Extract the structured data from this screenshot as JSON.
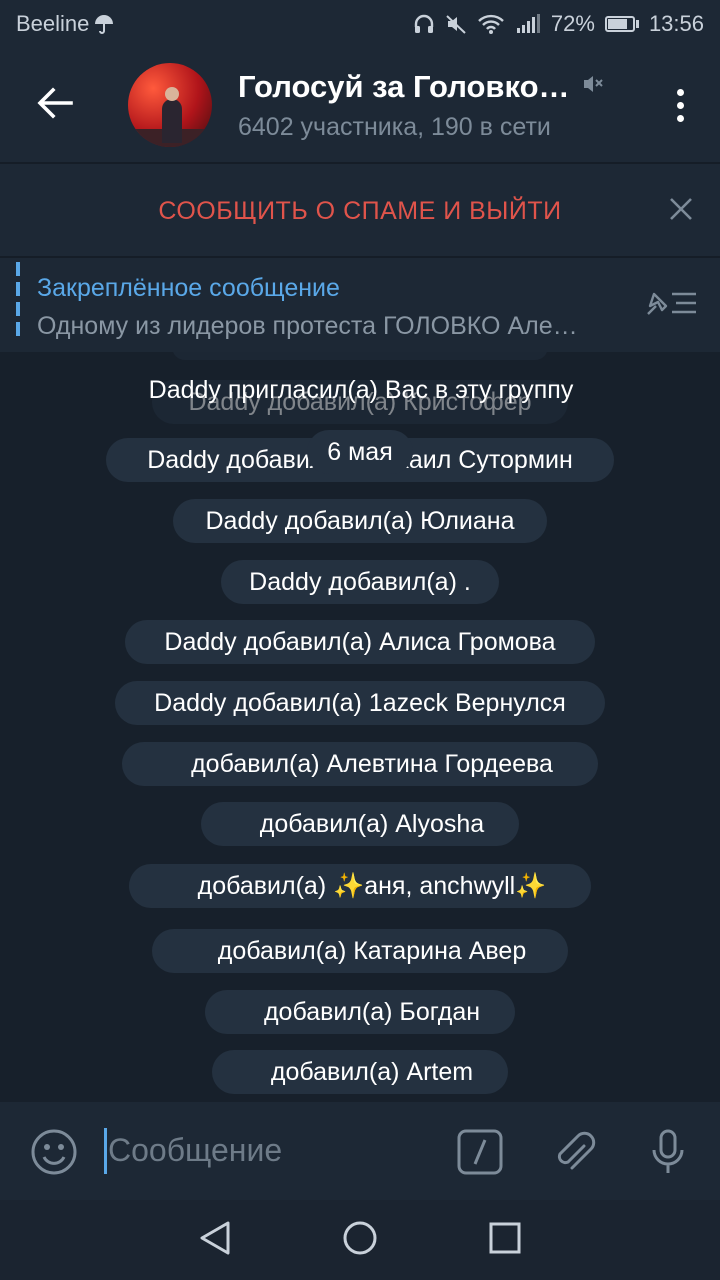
{
  "status_bar": {
    "carrier": "Beeline",
    "battery": "72%",
    "battery_level": 0.72,
    "time": "13:56"
  },
  "header": {
    "title": "Голосуй за Головко…",
    "subtitle": "6402 участника, 190 в сети"
  },
  "spam_bar": {
    "label": "СООБЩИТЬ О СПАМЕ И ВЫЙТИ"
  },
  "pinned": {
    "title": "Закреплённое сообщение",
    "text": "Одному из лидеров протеста ГОЛОВКО Але…"
  },
  "messages": {
    "ghost1": "Daddy добавил(а) Кристофер",
    "invite": "Daddy пригласил(а) Вас в эту группу",
    "date": "6 мая",
    "m1": "Daddy добавил(а) Михаил Сутормин",
    "m2": "Daddy добавил(а) Юлиана",
    "m3": "Daddy добавил(а) .",
    "m4": "Daddy добавил(а) Алиса Громова",
    "m5": "Daddy добавил(а) 1azeck Вернулся",
    "m6": "добавил(а) Алевтина Гордеева",
    "m7": "добавил(а) Alyosha",
    "m8": "добавил(а) ✨аня, anchwyll✨",
    "m9": "добавил(а) Катарина Авер",
    "m10": "добавил(а) Богдан",
    "m11": "добавил(а) Artem"
  },
  "composer": {
    "placeholder": "Сообщение"
  },
  "colors": {
    "background": "#17202b",
    "bar": "#1d2835",
    "pill": "#243140",
    "accent": "#5aa8e8",
    "danger": "#e0544b"
  },
  "icons": [
    "umbrella-icon",
    "headphones-icon",
    "mute-icon",
    "wifi-icon",
    "signal-icon",
    "battery-icon",
    "back-arrow-icon",
    "muted-speaker-icon",
    "more-vert-icon",
    "close-icon",
    "unpin-icon",
    "emoji-icon",
    "bot-command-icon",
    "attach-icon",
    "mic-icon",
    "nav-back-icon",
    "nav-home-icon",
    "nav-recents-icon"
  ]
}
